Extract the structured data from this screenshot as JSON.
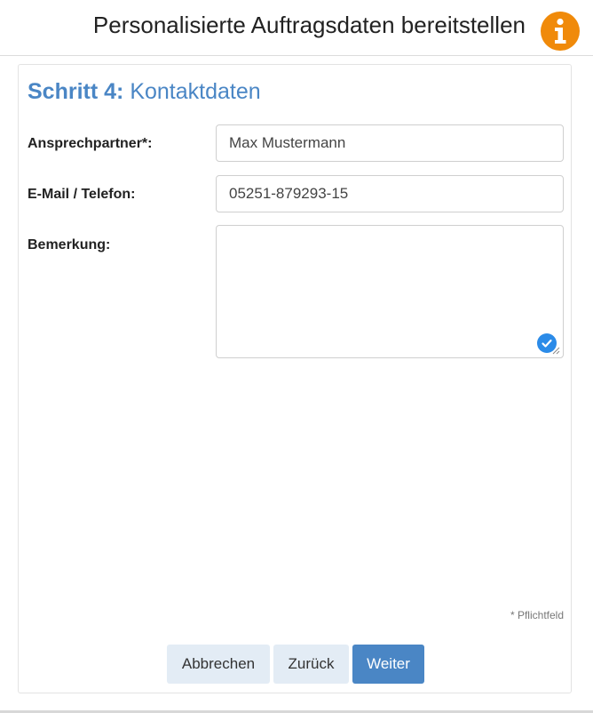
{
  "header": {
    "title": "Personalisierte Auftragsdaten bereitstellen",
    "info_icon": "info-icon",
    "info_color": "#f08a0a"
  },
  "step": {
    "number_label": "Schritt 4:",
    "title": "Kontaktdaten",
    "color": "#4a86c5"
  },
  "form": {
    "contact_label": "Ansprechpartner*:",
    "contact_value": "Max Mustermann",
    "email_label": "E-Mail / Telefon:",
    "email_value": "05251-879293-15",
    "remark_label": "Bemerkung:",
    "remark_value": "",
    "required_note": "* Pflichtfeld"
  },
  "buttons": {
    "cancel": "Abbrechen",
    "back": "Zurück",
    "next": "Weiter"
  }
}
